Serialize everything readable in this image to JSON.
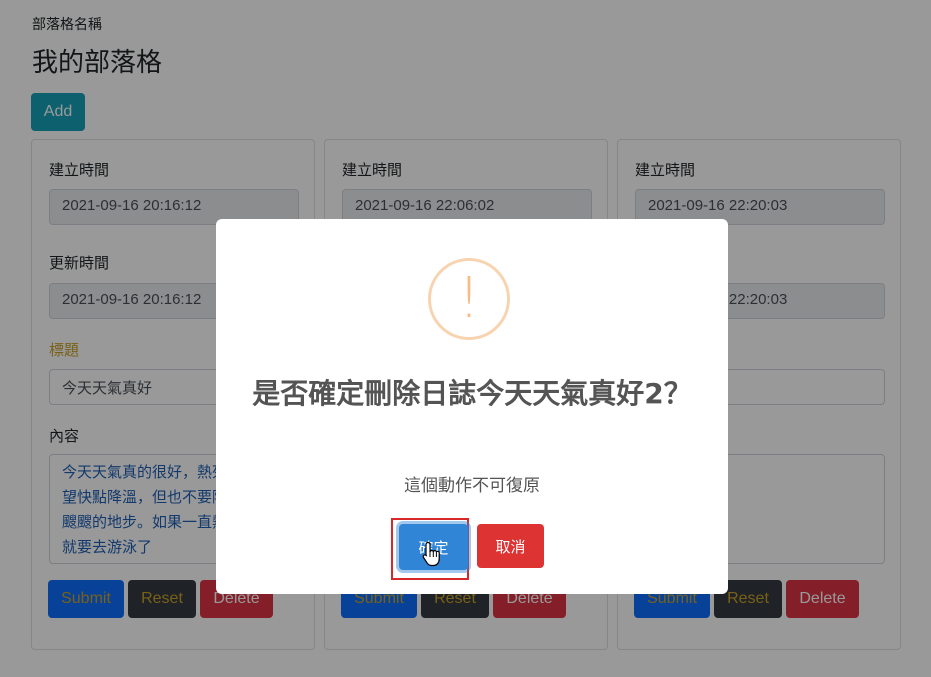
{
  "page": {
    "blog_name_label": "部落格名稱",
    "blog_name": "我的部落格",
    "add_label": "Add"
  },
  "cards": [
    {
      "created_label": "建立時間",
      "created_value": "2021-09-16 20:16:12",
      "updated_label": "更新時間",
      "updated_value": "2021-09-16 20:16:12",
      "title_label": "標題",
      "title_value": "今天天氣真好",
      "content_label": "內容",
      "content_value": "今天天氣真的很好，熱死了，希望快點降溫，但也不要降溫到冷颼颼的地步。如果一直熱下去，就要去游泳了",
      "submit_label": "Submit",
      "reset_label": "Reset",
      "delete_label": "Delete"
    },
    {
      "created_label": "建立時間",
      "created_value": "2021-09-16 22:06:02",
      "submit_label": "Submit",
      "reset_label": "Reset",
      "delete_label": "Delete"
    },
    {
      "created_label": "建立時間",
      "created_value": "2021-09-16 22:20:03",
      "updated_value": "2021-09-16 22:20:03",
      "submit_label": "Submit",
      "reset_label": "Reset",
      "delete_label": "Delete"
    }
  ],
  "dialog": {
    "icon": "!",
    "title": "是否確定刪除日誌今天天氣真好2？",
    "text": "這個動作不可復原",
    "confirm_label": "確定",
    "cancel_label": "取消"
  },
  "colors": {
    "confirm": "#3085d6",
    "cancel": "#dd3333",
    "warning": "#f8bb86",
    "add": "#17a2b8"
  }
}
